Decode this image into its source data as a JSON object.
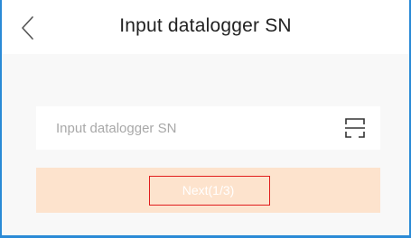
{
  "header": {
    "title": "Input datalogger SN",
    "back_icon": "chevron-left-icon"
  },
  "form": {
    "sn_input": {
      "value": "",
      "placeholder": "Input datalogger SN"
    },
    "scan_icon": "scan-icon"
  },
  "actions": {
    "next_label": "Next(1/3)"
  },
  "colors": {
    "frame_border": "#2a8ad6",
    "page_background": "#f8f8f8",
    "next_button_background": "#fde3cd",
    "highlight_box": "#e11d1d"
  }
}
